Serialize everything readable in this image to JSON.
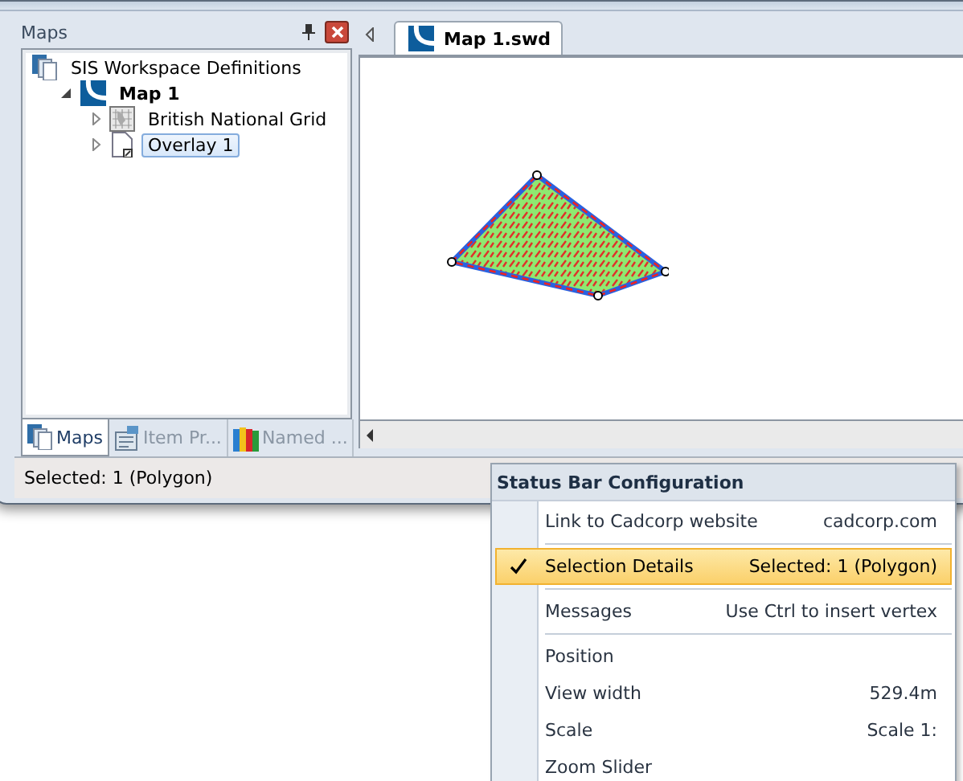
{
  "panel": {
    "title": "Maps"
  },
  "tree": [
    {
      "label": "SIS Workspace Definitions",
      "kind": "workspace",
      "children": [
        {
          "label": "Map 1",
          "kind": "map",
          "active": true,
          "expanded": true,
          "selected": false,
          "children": [
            {
              "label": "British National Grid",
              "kind": "grid",
              "expanded": false,
              "selected": false
            },
            {
              "label": "Overlay 1",
              "kind": "overlay",
              "expanded": false,
              "selected": true
            }
          ]
        }
      ]
    }
  ],
  "panel_tabs": [
    {
      "label": "Maps",
      "kind": "maps",
      "selected": true
    },
    {
      "label": "Item Pr...",
      "kind": "properties",
      "selected": false
    },
    {
      "label": "Named ...",
      "kind": "named",
      "selected": false
    }
  ],
  "document_tabs": [
    {
      "label": "Map 1.swd",
      "selected": true
    }
  ],
  "status_bar": {
    "text": "Selected: 1 (Polygon)"
  },
  "menu": {
    "title": "Status Bar Configuration",
    "groups": [
      [
        {
          "label": "Link to Cadcorp website",
          "value": "cadcorp.com",
          "checked": false,
          "selected": false
        }
      ],
      [
        {
          "label": "Selection Details",
          "value": "Selected: 1 (Polygon)",
          "checked": true,
          "selected": true
        }
      ],
      [
        {
          "label": "Messages",
          "value": "Use Ctrl to insert vertex",
          "checked": false,
          "selected": false
        }
      ],
      [
        {
          "label": "Position",
          "checked": false,
          "selected": false
        },
        {
          "label": "View width",
          "value": "529.4m",
          "checked": false,
          "selected": false
        },
        {
          "label": "Scale",
          "value": "Scale 1:",
          "checked": false,
          "selected": false
        },
        {
          "label": "Zoom Slider",
          "checked": false,
          "selected": false
        }
      ]
    ]
  }
}
